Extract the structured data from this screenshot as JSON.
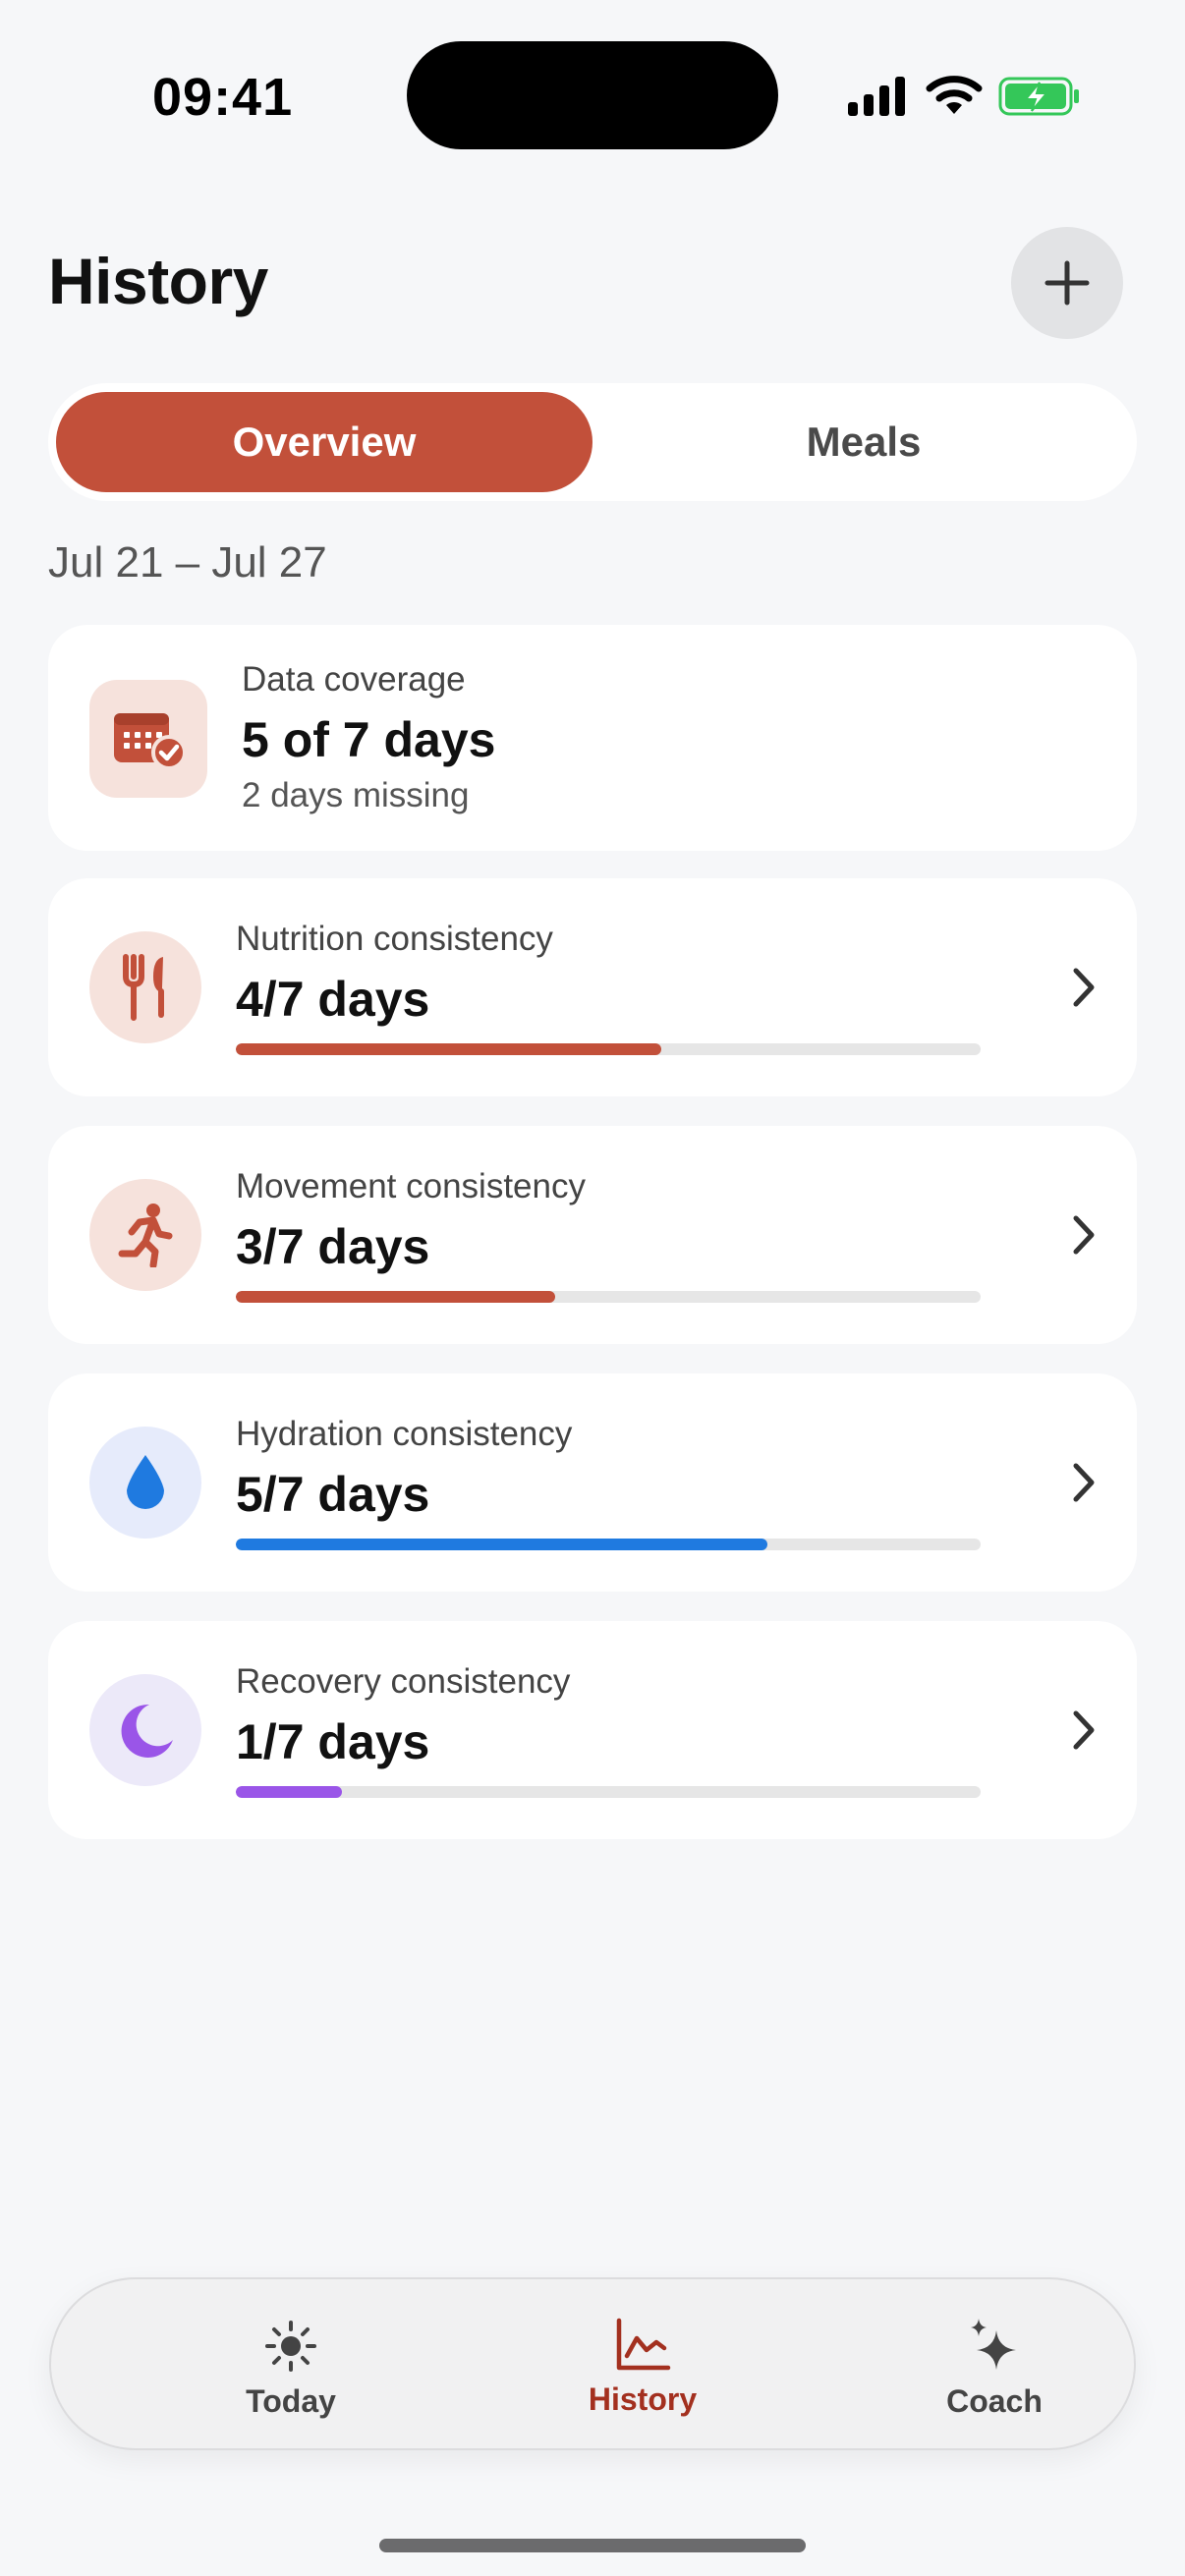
{
  "status_bar": {
    "time": "09:41"
  },
  "header": {
    "title": "History",
    "add_icon": "plus-icon"
  },
  "segmented": {
    "active": "Overview",
    "inactive": "Meals"
  },
  "date_range": "Jul 21 – Jul 27",
  "coverage": {
    "icon": "calendar-check-icon",
    "label": "Data coverage",
    "value": "5 of 7 days",
    "sub": "2 days missing",
    "accent": "#c2503a"
  },
  "metrics": [
    {
      "icon": "fork-knife-icon",
      "label": "Nutrition consistency",
      "value": "4/7 days",
      "progress": 0.571,
      "color": "#c2503a",
      "icon_bg": "#f6e2dc"
    },
    {
      "icon": "running-person-icon",
      "label": "Movement consistency",
      "value": "3/7 days",
      "progress": 0.429,
      "color": "#c2503a",
      "icon_bg": "#f6e2dc"
    },
    {
      "icon": "water-drop-icon",
      "label": "Hydration consistency",
      "value": "5/7 days",
      "progress": 0.714,
      "color": "#1f7ae0",
      "icon_bg": "#e6ebfb"
    },
    {
      "icon": "moon-icon",
      "label": "Recovery consistency",
      "value": "1/7 days",
      "progress": 0.143,
      "color": "#9a55e8",
      "icon_bg": "#ece9f9"
    }
  ],
  "tabs": [
    {
      "label": "Today",
      "icon": "sun-icon",
      "active": false
    },
    {
      "label": "History",
      "icon": "chart-icon",
      "active": true
    },
    {
      "label": "Coach",
      "icon": "sparkles-icon",
      "active": false
    }
  ],
  "colors": {
    "accent": "#c2503a",
    "active_tab": "#a3301f",
    "background": "#f6f7f9"
  }
}
